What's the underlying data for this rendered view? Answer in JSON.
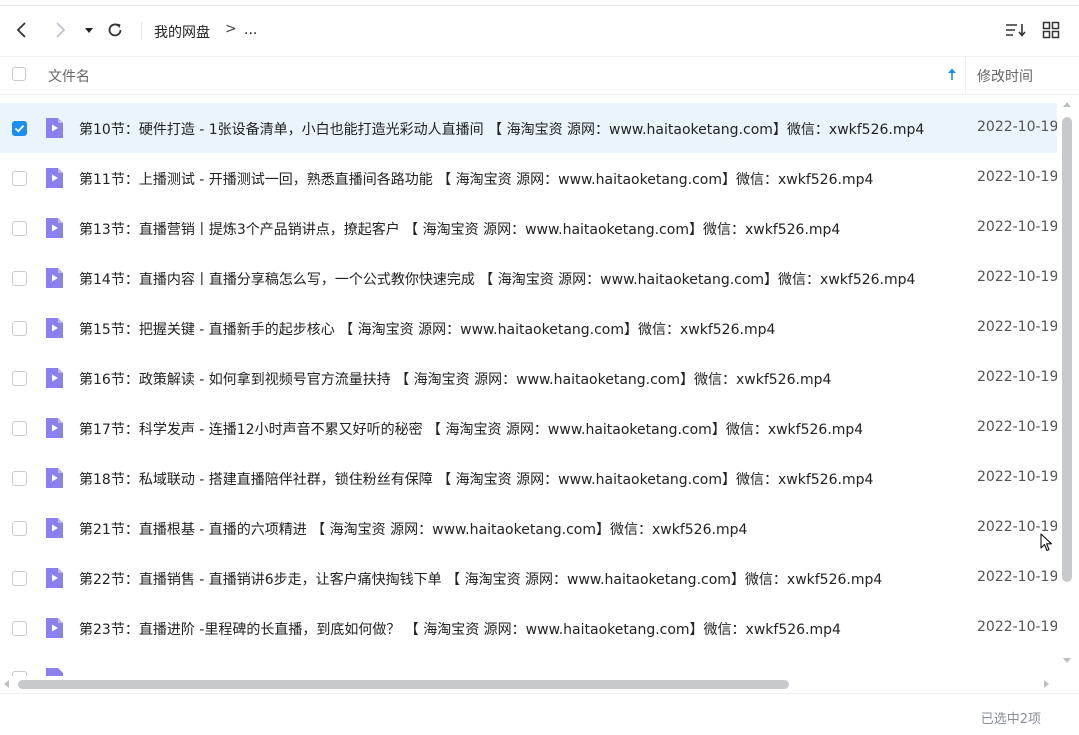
{
  "toolbar": {
    "breadcrumb_root": "我的网盘",
    "breadcrumb_sep": ">",
    "breadcrumb_more": "..."
  },
  "header": {
    "name_label": "文件名",
    "time_label": "修改时间"
  },
  "files": [
    {
      "name": "第10节：硬件打造 - 1张设备清单，小白也能打造光彩动人直播间 【 海淘宝资 源网：www.haitaoketang.com】微信：xwkf526.mp4",
      "date": "2022-10-19",
      "checked": true
    },
    {
      "name": "第11节：上播测试 - 开播测试一回，熟悉直播间各路功能 【 海淘宝资 源网：www.haitaoketang.com】微信：xwkf526.mp4",
      "date": "2022-10-19",
      "checked": false
    },
    {
      "name": "第13节：直播营销丨提炼3个产品销讲点，撩起客户 【 海淘宝资 源网：www.haitaoketang.com】微信：xwkf526.mp4",
      "date": "2022-10-19",
      "checked": false
    },
    {
      "name": "第14节：直播内容丨直播分享稿怎么写，一个公式教你快速完成 【 海淘宝资 源网：www.haitaoketang.com】微信：xwkf526.mp4",
      "date": "2022-10-19",
      "checked": false
    },
    {
      "name": "第15节：把握关键 - 直播新手的起步核心 【 海淘宝资 源网：www.haitaoketang.com】微信：xwkf526.mp4",
      "date": "2022-10-19",
      "checked": false
    },
    {
      "name": "第16节：政策解读 - 如何拿到视频号官方流量扶持 【 海淘宝资 源网：www.haitaoketang.com】微信：xwkf526.mp4",
      "date": "2022-10-19",
      "checked": false
    },
    {
      "name": "第17节：科学发声 - 连播12小时声音不累又好听的秘密 【 海淘宝资 源网：www.haitaoketang.com】微信：xwkf526.mp4",
      "date": "2022-10-19",
      "checked": false
    },
    {
      "name": "第18节：私域联动 - 搭建直播陪伴社群，锁住粉丝有保障 【 海淘宝资 源网：www.haitaoketang.com】微信：xwkf526.mp4",
      "date": "2022-10-19",
      "checked": false
    },
    {
      "name": "第21节：直播根基 - 直播的六项精进 【 海淘宝资 源网：www.haitaoketang.com】微信：xwkf526.mp4",
      "date": "2022-10-19",
      "checked": false
    },
    {
      "name": "第22节：直播销售 - 直播销讲6步走，让客户痛快掏钱下单 【 海淘宝资 源网：www.haitaoketang.com】微信：xwkf526.mp4",
      "date": "2022-10-19",
      "checked": false
    },
    {
      "name": "第23节：直播进阶 -里程碑的长直播，到底如何做？ 【 海淘宝资 源网：www.haitaoketang.com】微信：xwkf526.mp4",
      "date": "2022-10-19",
      "checked": false
    }
  ],
  "footer": {
    "status": "已选中2项"
  },
  "colors": {
    "accent": "#1a8ef5",
    "file_icon": "#8a80f0",
    "selected_row": "#e9f4fd"
  },
  "icons": [
    "back-arrow-icon",
    "forward-arrow-icon",
    "dropdown-caret-icon",
    "refresh-icon",
    "sort-icon",
    "grid-view-icon",
    "sort-asc-arrow-icon",
    "video-file-icon"
  ]
}
